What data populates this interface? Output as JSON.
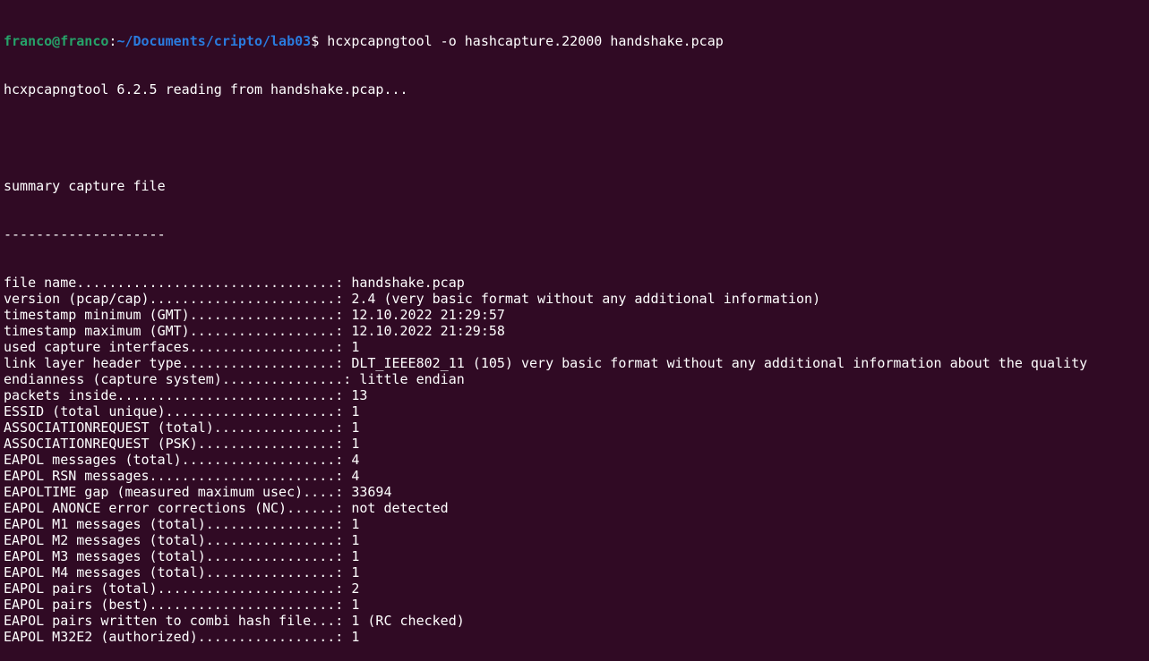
{
  "prompt": {
    "user_host": "franco@franco",
    "sep": ":",
    "path": "~/Documents/cripto/lab03",
    "symbol": "$",
    "command": " hcxpcapngtool -o hashcapture.22000 handshake.pcap"
  },
  "output_header": "hcxpcapngtool 6.2.5 reading from handshake.pcap...",
  "summary_title": "summary capture file",
  "summary_rule": "--------------------",
  "rows": [
    {
      "label": "file name................................",
      "value": ": handshake.pcap"
    },
    {
      "label": "version (pcap/cap).......................",
      "value": ": 2.4 (very basic format without any additional information)"
    },
    {
      "label": "timestamp minimum (GMT)..................",
      "value": ": 12.10.2022 21:29:57"
    },
    {
      "label": "timestamp maximum (GMT)..................",
      "value": ": 12.10.2022 21:29:58"
    },
    {
      "label": "used capture interfaces..................",
      "value": ": 1"
    },
    {
      "label": "link layer header type...................",
      "value": ": DLT_IEEE802_11 (105) very basic format without any additional information about the quality"
    },
    {
      "label": "endianness (capture system)...............",
      "value": ": little endian"
    },
    {
      "label": "packets inside...........................",
      "value": ": 13"
    },
    {
      "label": "ESSID (total unique).....................",
      "value": ": 1"
    },
    {
      "label": "ASSOCIATIONREQUEST (total)...............",
      "value": ": 1"
    },
    {
      "label": "ASSOCIATIONREQUEST (PSK).................",
      "value": ": 1"
    },
    {
      "label": "EAPOL messages (total)...................",
      "value": ": 4"
    },
    {
      "label": "EAPOL RSN messages.......................",
      "value": ": 4"
    },
    {
      "label": "EAPOLTIME gap (measured maximum usec)....",
      "value": ": 33694"
    },
    {
      "label": "EAPOL ANONCE error corrections (NC)......",
      "value": ": not detected"
    },
    {
      "label": "EAPOL M1 messages (total)................",
      "value": ": 1"
    },
    {
      "label": "EAPOL M2 messages (total)................",
      "value": ": 1"
    },
    {
      "label": "EAPOL M3 messages (total)................",
      "value": ": 1"
    },
    {
      "label": "EAPOL M4 messages (total)................",
      "value": ": 1"
    },
    {
      "label": "EAPOL pairs (total)......................",
      "value": ": 2"
    },
    {
      "label": "EAPOL pairs (best).......................",
      "value": ": 1"
    },
    {
      "label": "EAPOL pairs written to combi hash file...",
      "value": ": 1 (RC checked)"
    },
    {
      "label": "EAPOL M32E2 (authorized).................",
      "value": ": 1"
    }
  ]
}
